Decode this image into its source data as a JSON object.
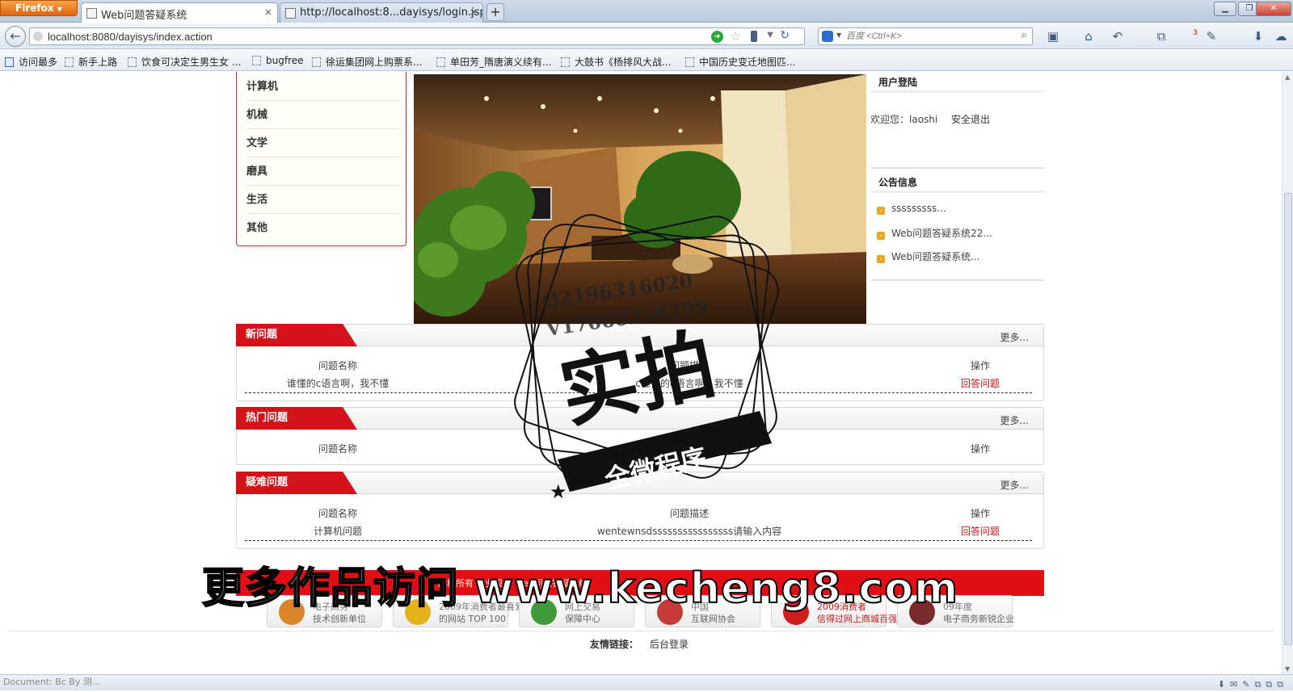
{
  "browser": {
    "app_button": "Firefox",
    "tabs": [
      {
        "label": "Web问题答疑系统",
        "close": "×"
      },
      {
        "label": "http://localhost:8...dayisys/login.jsp",
        "close": "×"
      }
    ],
    "new_tab": "+",
    "url": "localhost:8080/dayisys/index.action",
    "search_placeholder": "百度 <Ctrl+K>",
    "notification_count": "3",
    "bookmarks": [
      "访问最多",
      "新手上路",
      "饮食可决定生男生女 ...",
      "bugfree",
      "徐运集团网上购票系...",
      "单田芳_隋唐演义续有...",
      "大鼓书《杨排风大战...",
      "中国历史变迁地图匹..."
    ],
    "status_text": "Document: Bc By 测..."
  },
  "categories": [
    "计算机",
    "机械",
    "文学",
    "磨具",
    "生活",
    "其他"
  ],
  "login": {
    "title": "用户登陆",
    "welcome": "欢迎您：laoshi",
    "logout": "安全退出"
  },
  "notice": {
    "title": "公告信息",
    "items": [
      "sssssssss...",
      "Web问题答疑系统22...",
      "Web问题答疑系统..."
    ]
  },
  "sections": {
    "new": {
      "title": "新问题",
      "more": "更多...",
      "headers": [
        "问题名称",
        "问题描述",
        "操作"
      ],
      "rows": [
        [
          "谁懂的c语言啊，我不懂",
          "c谁懂的c语言啊，我不懂",
          "回答问题"
        ]
      ]
    },
    "hot": {
      "title": "热门问题",
      "more": "更多...",
      "headers": [
        "问题名称",
        "问题描述",
        "操作"
      ]
    },
    "hard": {
      "title": "疑难问题",
      "more": "更多...",
      "headers": [
        "问题名称",
        "问题描述",
        "操作"
      ],
      "rows": [
        [
          "计算机问题",
          "wentewnsdssssssssssssssss请输入内容",
          "回答问题"
        ]
      ]
    }
  },
  "footer": {
    "bar_text": "版权所有 毕业设计 Web问题答疑系统",
    "badges": [
      {
        "l1": "电子商务",
        "l2": "技术创新单位",
        "color": "#d9862a"
      },
      {
        "l1": "2009年消费者最喜爱",
        "l2": "的网站 TOP 100",
        "color": "#e3b21b"
      },
      {
        "l1": "网上交易",
        "l2": "保障中心",
        "color": "#3f9a3a"
      },
      {
        "l1": "中国",
        "l2": "互联网协会",
        "color": "#c63b38"
      },
      {
        "l1": "2009消费者",
        "l2": "信得过网上商城百强",
        "color": "#d11d1d"
      },
      {
        "l1": "09年度",
        "l2": "电子商务新锐企业",
        "color": "#7a2a2a"
      }
    ],
    "friend_label": "友情链接：",
    "friend_link": "后台登录"
  },
  "watermark": {
    "contact1": "Q2196316020",
    "contact2": "V17060256299",
    "big": "实拍",
    "ribbon": "全微程序",
    "caption": "更多作品访问 www.kecheng8.com"
  }
}
